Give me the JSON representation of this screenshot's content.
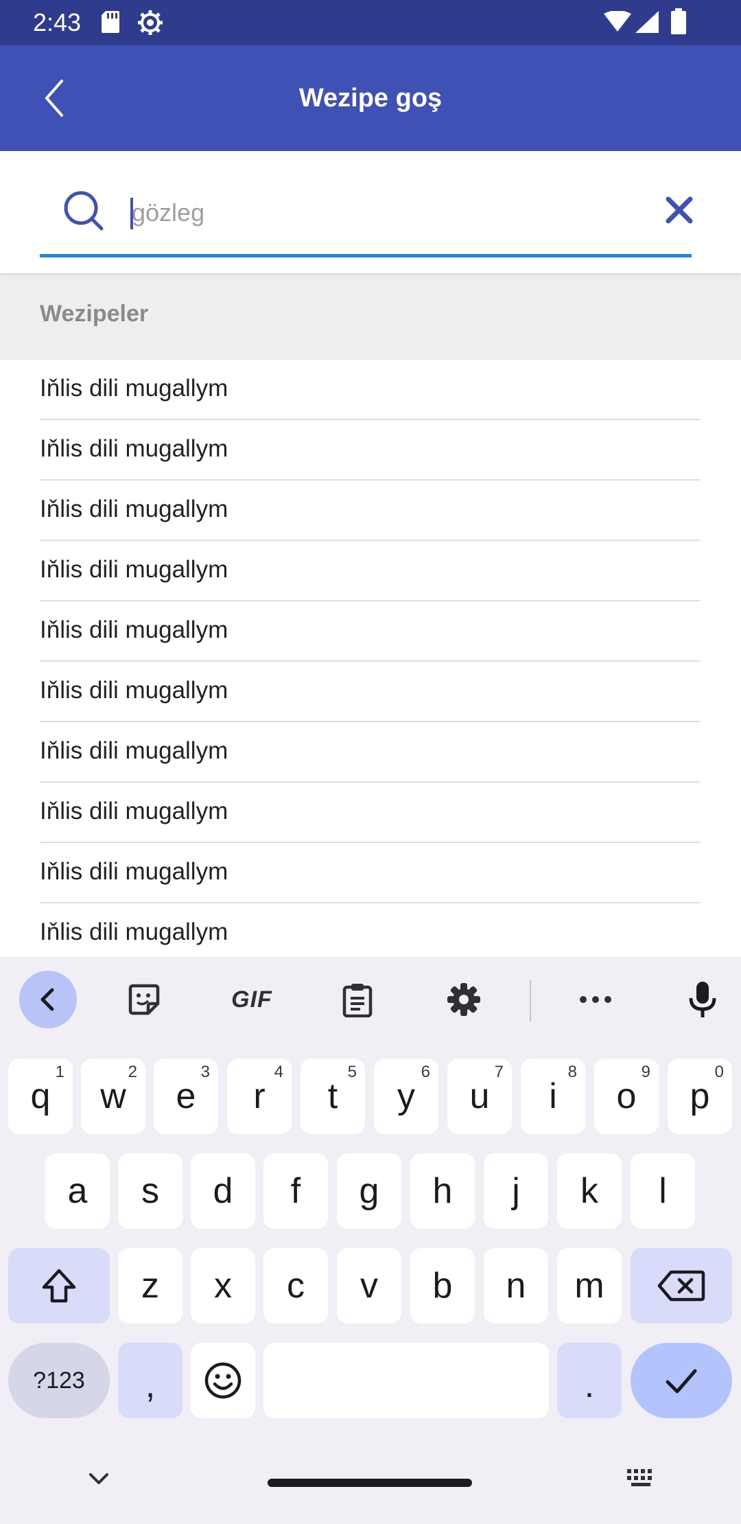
{
  "status_bar": {
    "time": "2:43",
    "icons": [
      "sd-card-icon",
      "settings-gear-icon",
      "wifi-icon",
      "cell-signal-icon",
      "battery-icon"
    ]
  },
  "app_bar": {
    "title": "Wezipe goş",
    "back_icon": "chevron-left-icon"
  },
  "search": {
    "placeholder": "gözleg",
    "value": "",
    "icon": "search-icon",
    "clear_icon": "close-icon"
  },
  "section": {
    "title": "Wezipeler"
  },
  "list": {
    "items": [
      "Iňlis dili mugallym",
      "Iňlis dili mugallym",
      "Iňlis dili mugallym",
      "Iňlis dili mugallym",
      "Iňlis dili mugallym",
      "Iňlis dili mugallym",
      "Iňlis dili mugallym",
      "Iňlis dili mugallym",
      "Iňlis dili mugallym",
      "Iňlis dili mugallym"
    ]
  },
  "keyboard": {
    "toolbar": {
      "gif_label": "GIF",
      "icons": [
        "chevron-left-icon",
        "sticker-icon",
        "gif-icon",
        "clipboard-icon",
        "settings-icon",
        "more-icon",
        "microphone-icon"
      ]
    },
    "row1": [
      {
        "key": "q",
        "hint": "1"
      },
      {
        "key": "w",
        "hint": "2"
      },
      {
        "key": "e",
        "hint": "3"
      },
      {
        "key": "r",
        "hint": "4"
      },
      {
        "key": "t",
        "hint": "5"
      },
      {
        "key": "y",
        "hint": "6"
      },
      {
        "key": "u",
        "hint": "7"
      },
      {
        "key": "i",
        "hint": "8"
      },
      {
        "key": "o",
        "hint": "9"
      },
      {
        "key": "p",
        "hint": "0"
      }
    ],
    "row2": [
      "a",
      "s",
      "d",
      "f",
      "g",
      "h",
      "j",
      "k",
      "l"
    ],
    "row3": [
      "z",
      "x",
      "c",
      "v",
      "b",
      "n",
      "m"
    ],
    "symbols_label": "?123",
    "comma_label": ",",
    "period_label": "."
  },
  "colors": {
    "status_bar": "#2f3c8e",
    "app_bar": "#3f51b5",
    "accent": "#1e88e5",
    "keyboard_bg": "#f1eef5"
  }
}
